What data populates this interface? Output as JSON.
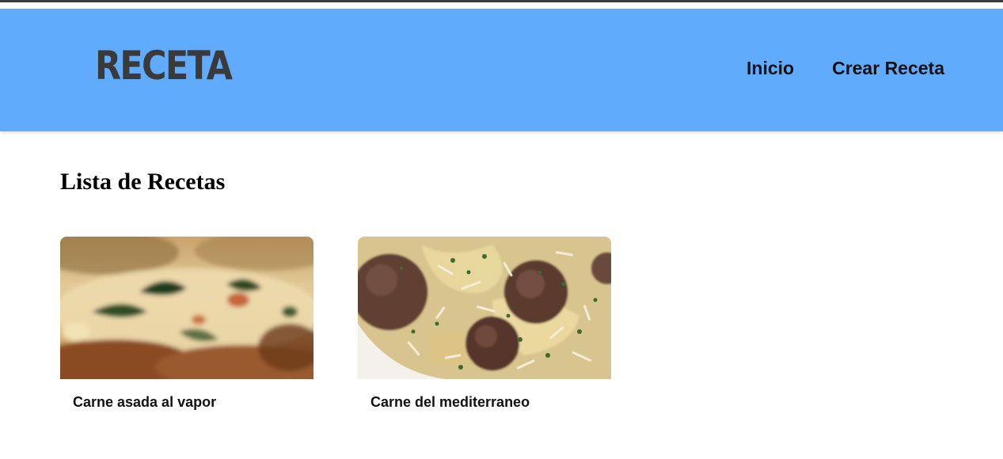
{
  "header": {
    "logo": "RECETA",
    "nav": [
      {
        "label": "Inicio"
      },
      {
        "label": "Crear Receta"
      }
    ],
    "background": "#61abfd"
  },
  "main": {
    "title": "Lista de Recetas",
    "recipes": [
      {
        "title": "Carne asada al vapor"
      },
      {
        "title": "Carne del mediterraneo"
      }
    ]
  }
}
